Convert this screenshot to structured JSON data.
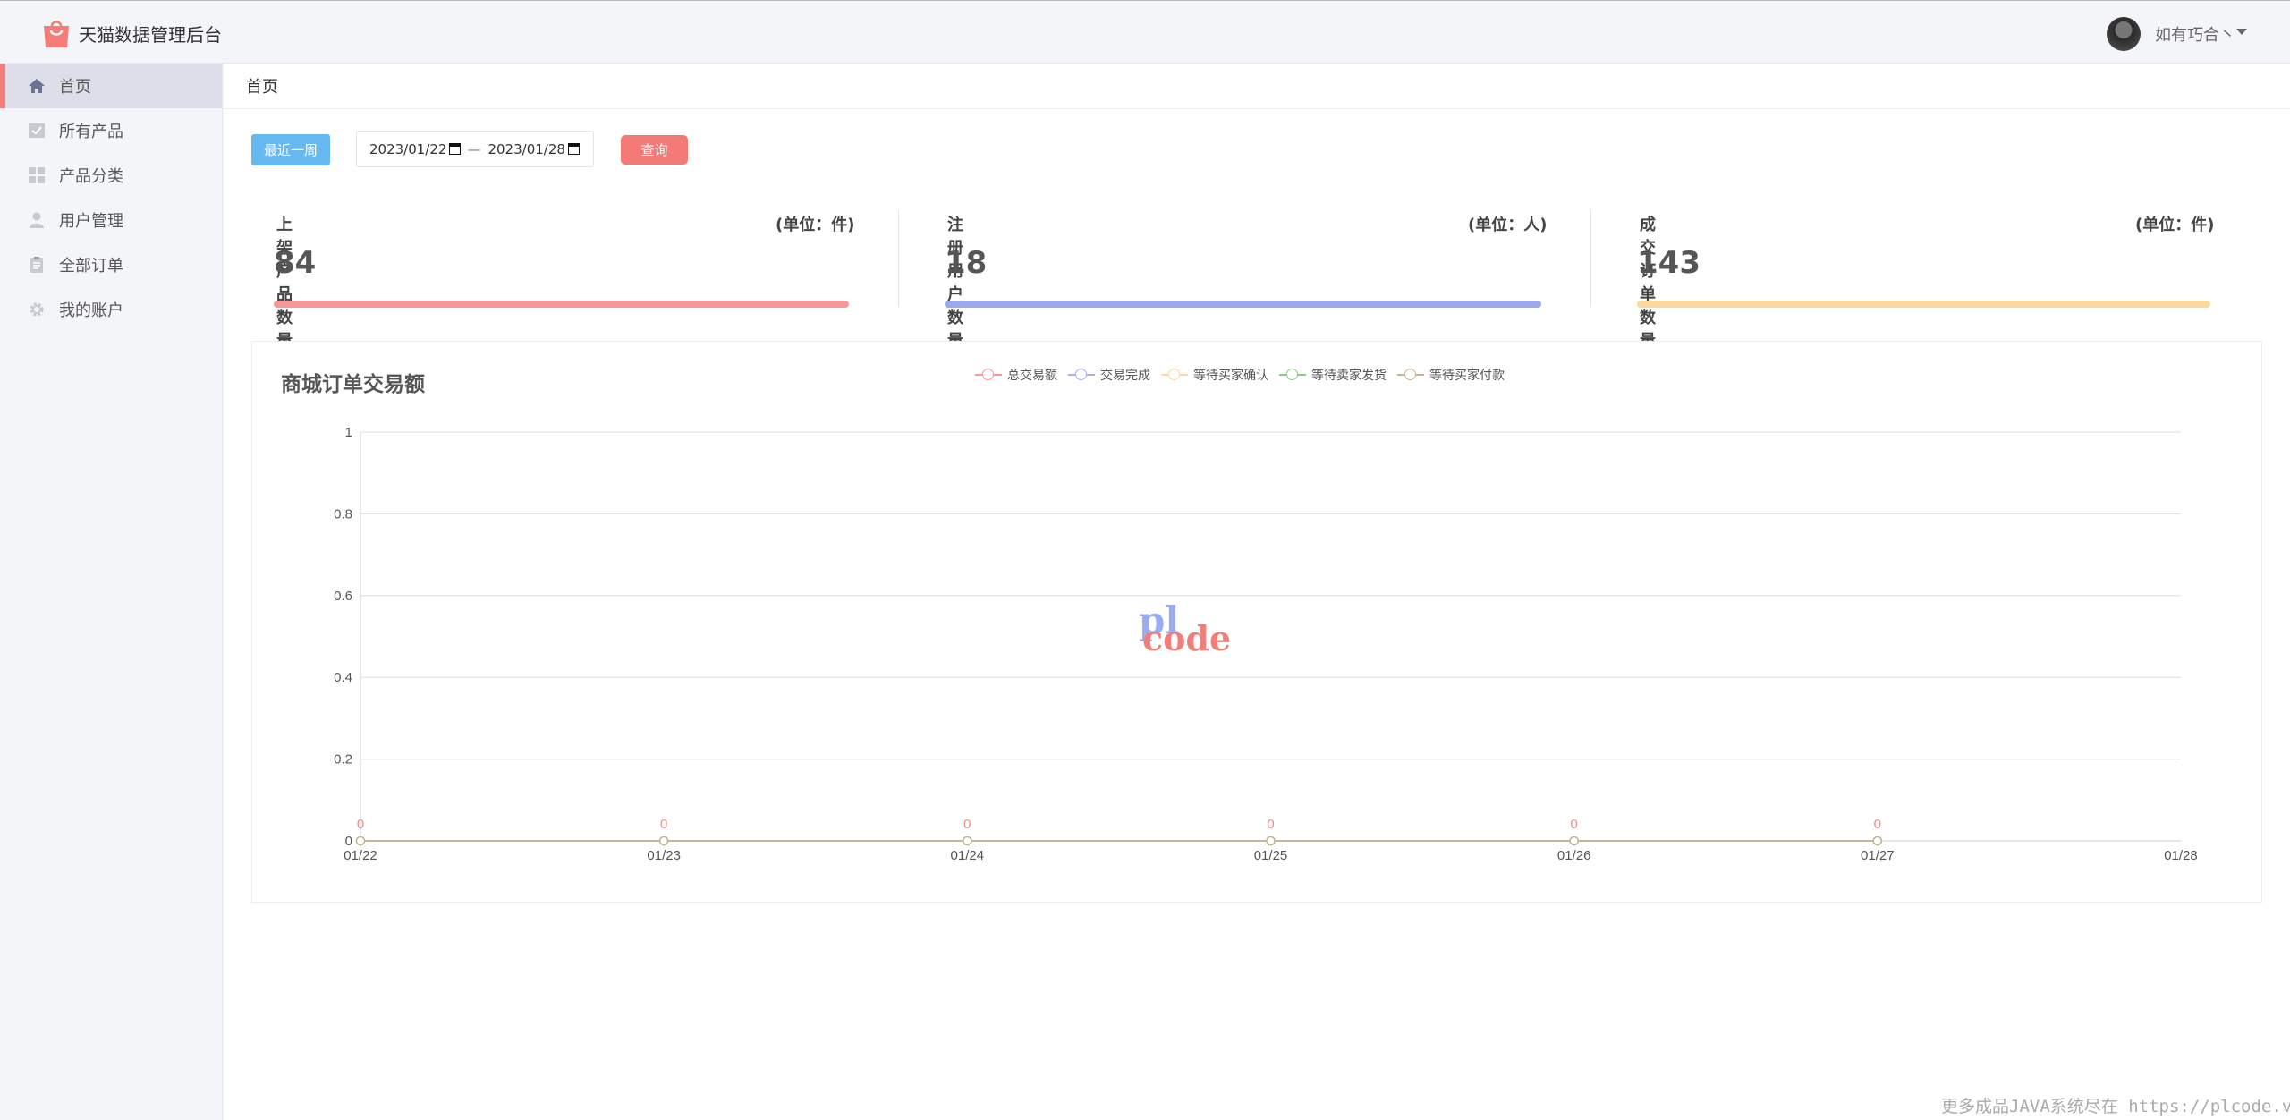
{
  "header": {
    "app_title": "天猫数据管理后台",
    "username": "如有巧合丶"
  },
  "sidebar": {
    "items": [
      {
        "label": "首页",
        "icon": "home-icon"
      },
      {
        "label": "所有产品",
        "icon": "check-square-icon"
      },
      {
        "label": "产品分类",
        "icon": "grid-icon"
      },
      {
        "label": "用户管理",
        "icon": "user-icon"
      },
      {
        "label": "全部订单",
        "icon": "clipboard-icon"
      },
      {
        "label": "我的账户",
        "icon": "gear-icon"
      }
    ]
  },
  "breadcrumb": "首页",
  "filters": {
    "week_button": "最近一周",
    "date_start": "2023/01/22",
    "date_end": "2023/01/28",
    "date_separator": "—",
    "query_button": "查询"
  },
  "stats": [
    {
      "title": "上架产品数量",
      "unit": "(单位：件)",
      "value": "84",
      "color": "#f39a98"
    },
    {
      "title": "注册用户数量",
      "unit": "(单位：人)",
      "value": "18",
      "color": "#9da9ed"
    },
    {
      "title": "成交订单数量",
      "unit": "(单位：件)",
      "value": "143",
      "color": "#fbd99c"
    }
  ],
  "chart_data": {
    "type": "line",
    "title": "商城订单交易额",
    "categories": [
      "01/22",
      "01/23",
      "01/24",
      "01/25",
      "01/26",
      "01/27",
      "01/28"
    ],
    "ylim": [
      0,
      1
    ],
    "yticks": [
      0,
      0.2,
      0.4,
      0.6,
      0.8,
      1
    ],
    "grid": true,
    "legend_position": "top-center",
    "series": [
      {
        "name": "总交易额",
        "color": "#f49a98",
        "values": [
          0,
          0,
          0,
          0,
          0,
          0
        ]
      },
      {
        "name": "交易完成",
        "color": "#a7b1ec",
        "values": [
          0,
          0,
          0,
          0,
          0,
          0
        ]
      },
      {
        "name": "等待买家确认",
        "color": "#fcd8a2",
        "values": [
          0,
          0,
          0,
          0,
          0,
          0
        ]
      },
      {
        "name": "等待卖家发货",
        "color": "#8ec98b",
        "values": [
          0,
          0,
          0,
          0,
          0,
          0
        ]
      },
      {
        "name": "等待买家付款",
        "color": "#c8b496",
        "values": [
          0,
          0,
          0,
          0,
          0,
          0
        ]
      }
    ],
    "data_labels": [
      "0",
      "0",
      "0",
      "0",
      "0",
      "0"
    ],
    "data_label_color": "#f08b87"
  },
  "watermark": {
    "top": "pl",
    "bottom": "code"
  },
  "footer_note": "更多成品JAVA系统尽在 https://plcode.vip"
}
